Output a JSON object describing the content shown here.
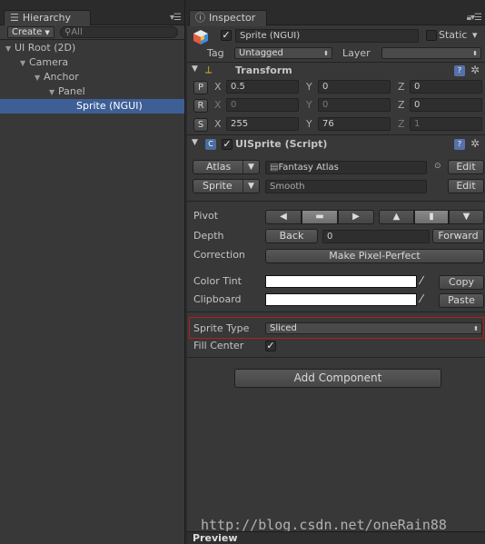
{
  "hierarchy": {
    "tab_label": "Hierarchy",
    "create_label": "Create",
    "search_placeholder": "All",
    "items": [
      {
        "label": "UI Root (2D)"
      },
      {
        "label": "Camera"
      },
      {
        "label": "Anchor"
      },
      {
        "label": "Panel"
      },
      {
        "label": "Sprite (NGUI)"
      }
    ]
  },
  "inspector": {
    "tab_label": "Inspector",
    "object": {
      "name": "Sprite (NGUI)",
      "static_label": "Static",
      "tag_label": "Tag",
      "tag_value": "Untagged",
      "layer_label": "Layer",
      "layer_value": ""
    },
    "transform": {
      "title": "Transform",
      "p_label": "P",
      "r_label": "R",
      "s_label": "S",
      "x_label": "X",
      "y_label": "Y",
      "z_label": "Z",
      "position": {
        "x": "0.5",
        "y": "0",
        "z": "0"
      },
      "rotation": {
        "x": "0",
        "y": "0",
        "z": "0"
      },
      "scale": {
        "x": "255",
        "y": "76",
        "z": "1"
      }
    },
    "uisprite": {
      "title": "UISprite (Script)",
      "atlas_label": "Atlas",
      "atlas_value": "Fantasy Atlas",
      "sprite_label": "Sprite",
      "sprite_value": "Smooth",
      "edit_label": "Edit",
      "pivot_label": "Pivot",
      "depth_label": "Depth",
      "back_label": "Back",
      "depth_value": "0",
      "forward_label": "Forward",
      "correction_label": "Correction",
      "make_pixel_perfect_label": "Make Pixel-Perfect",
      "color_tint_label": "Color Tint",
      "copy_label": "Copy",
      "clipboard_label": "Clipboard",
      "paste_label": "Paste",
      "sprite_type_label": "Sprite Type",
      "sprite_type_value": "Sliced",
      "fill_center_label": "Fill Center",
      "fill_center_checked": true
    },
    "add_component_label": "Add Component",
    "preview_label": "Preview"
  },
  "watermark": "http://blog.csdn.net/oneRain88",
  "colors": {
    "selection": "#3e5f96",
    "highlight_border": "#b0201e",
    "color_tint": "#ffffff"
  }
}
